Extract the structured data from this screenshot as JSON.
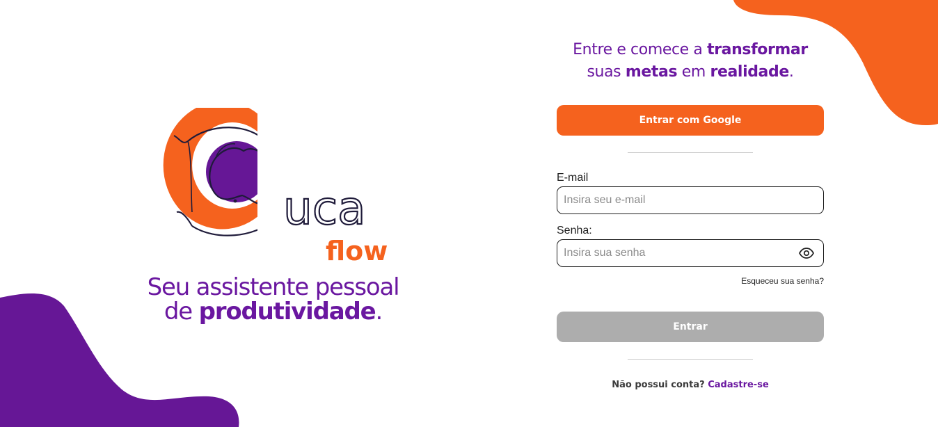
{
  "colors": {
    "accent_orange": "#f5621e",
    "brand_purple": "#6a17a0",
    "disabled_button": "#adadad"
  },
  "brand": {
    "logo_letters": "uca",
    "logo_sub": "flow",
    "tagline_line1": "Seu assistente pessoal",
    "tagline_prefix": "de ",
    "tagline_bold": "produtividade",
    "tagline_suffix": "."
  },
  "headline": {
    "part1": "Entre e comece a ",
    "bold1": "transformar",
    "part2": "suas ",
    "bold2": "metas",
    "part3": " em ",
    "bold3": "realidade",
    "part4": "."
  },
  "google_button_label": "Entrar com Google",
  "email": {
    "label": "E-mail",
    "placeholder": "Insira seu e-mail",
    "value": ""
  },
  "password": {
    "label": "Senha:",
    "placeholder": "Insira sua senha",
    "value": "",
    "toggle_icon": "eye-icon"
  },
  "forgot_password_link": "Esqueceu sua senha?",
  "submit_button_label": "Entrar",
  "signup": {
    "prompt": "Não possui conta? ",
    "link": "Cadastre-se"
  }
}
